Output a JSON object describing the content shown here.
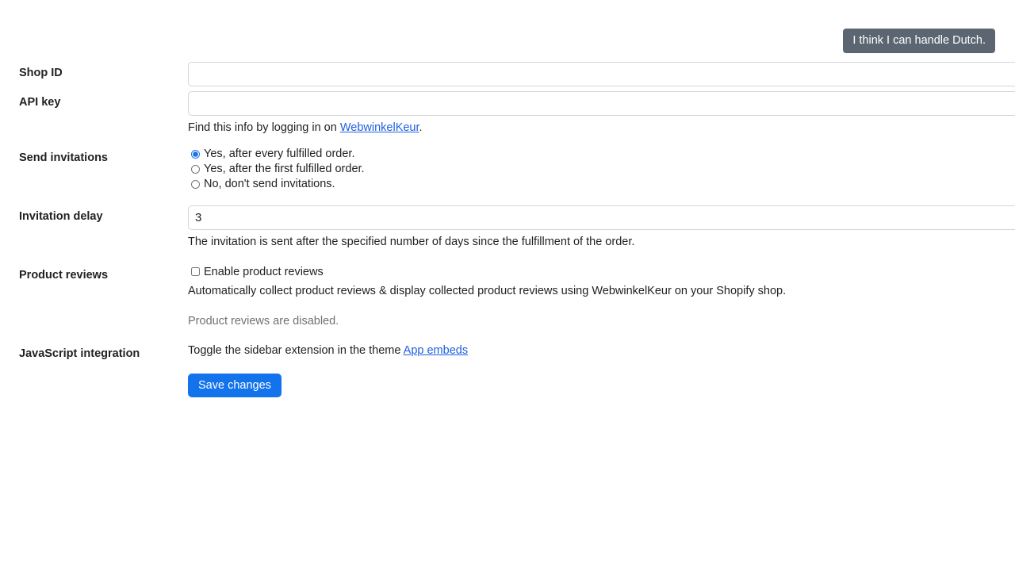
{
  "topbar": {
    "language_button": "I think I can handle Dutch."
  },
  "form": {
    "shop_id": {
      "label": "Shop ID",
      "value": "",
      "placeholder": "",
      "autofill_icon": "contact-card-icon"
    },
    "api_key": {
      "label": "API key",
      "value": "",
      "placeholder": "",
      "help_prefix": "Find this info by logging in on ",
      "help_link": "WebwinkelKeur",
      "help_suffix": "."
    },
    "send_invitations": {
      "label": "Send invitations",
      "selected": 0,
      "options": [
        "Yes, after every fulfilled order.",
        "Yes, after the first fulfilled order.",
        "No, don't send invitations."
      ]
    },
    "invitation_delay": {
      "label": "Invitation delay",
      "value": "3",
      "help": "The invitation is sent after the specified number of days since the fulfillment of the order."
    },
    "product_reviews": {
      "label": "Product reviews",
      "checkbox_label": "Enable product reviews",
      "checked": false,
      "description": "Automatically collect product reviews & display collected product reviews using WebwinkelKeur on your Shopify shop.",
      "status": "Product reviews are disabled."
    },
    "javascript_integration": {
      "label": "JavaScript integration",
      "text_prefix": "Toggle the sidebar extension in the theme ",
      "link": "App embeds"
    },
    "save_label": "Save changes"
  },
  "colors": {
    "accent_blue": "#1273ec",
    "link_blue": "#2060df",
    "slate_button": "#5c6672",
    "muted_text": "#6d7175",
    "text": "#202223",
    "border": "#d2d5d9"
  }
}
